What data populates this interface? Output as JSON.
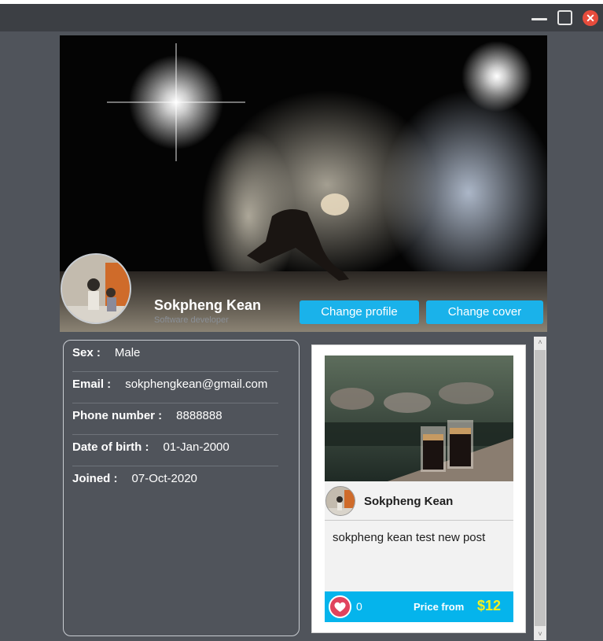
{
  "window": {
    "minimize_icon": "minimize-icon",
    "maximize_icon": "maximize-icon",
    "close_icon": "close-icon",
    "close_glyph": "✕",
    "close_color": "#e74c3c"
  },
  "profile": {
    "name": "Sokpheng Kean",
    "role": "Software developer",
    "change_profile_label": "Change profile",
    "change_cover_label": "Change cover",
    "accent_color": "#1ab2ea"
  },
  "info": [
    {
      "label": "Sex :",
      "value": "Male"
    },
    {
      "label": "Email :",
      "value": "sokphengkean@gmail.com"
    },
    {
      "label": "Phone number :",
      "value": "8888888"
    },
    {
      "label": "Date of birth :",
      "value": "01-Jan-2000"
    },
    {
      "label": "Joined :",
      "value": "07-Oct-2020"
    }
  ],
  "post": {
    "author": "Sokpheng Kean",
    "text": "sokpheng kean test new post",
    "likes": "0",
    "heart_icon": "heart-icon",
    "price_label": "Price from",
    "price": "$12",
    "price_color": "#f4f11e",
    "footer_color": "#05b4ec"
  },
  "scroll": {
    "up_glyph": "˄",
    "down_glyph": "˅"
  }
}
